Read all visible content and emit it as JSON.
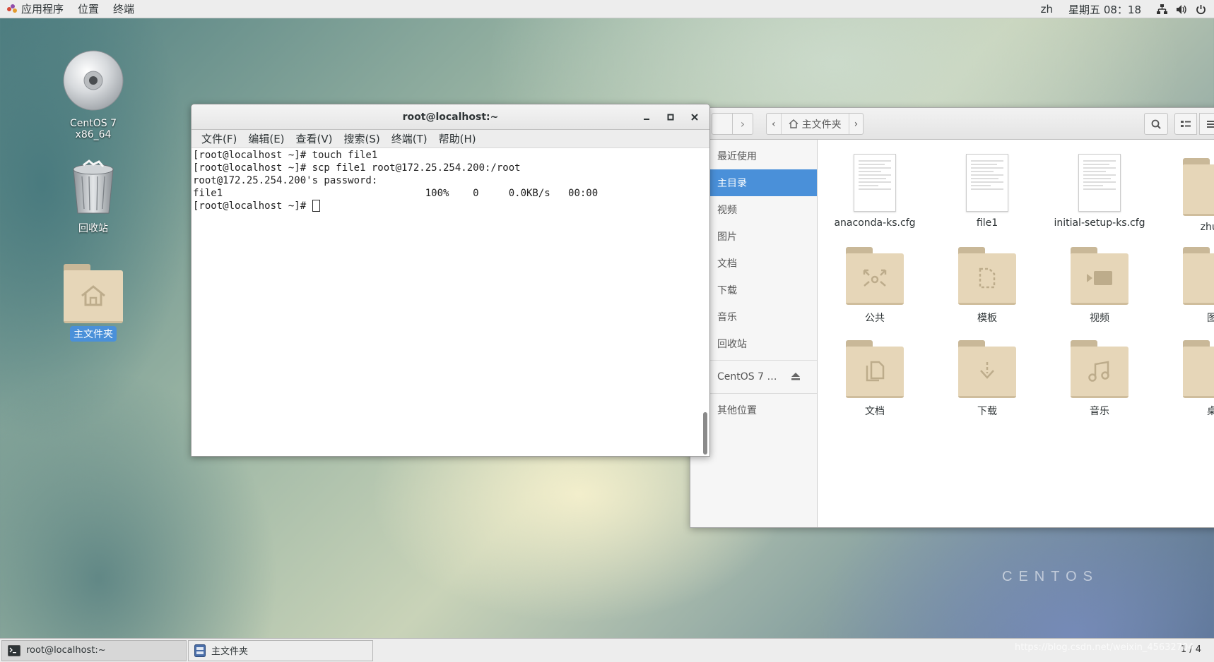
{
  "topbar": {
    "apps": "应用程序",
    "places": "位置",
    "terminal": "终端",
    "lang": "zh",
    "clock": "星期五 08：18",
    "icons": [
      "network-icon",
      "volume-icon",
      "power-icon"
    ]
  },
  "desktop": {
    "icons": [
      {
        "label": "CentOS 7 x86_64",
        "icon": "disc-icon"
      },
      {
        "label": "回收站",
        "icon": "trash-icon"
      },
      {
        "label": "主文件夹",
        "icon": "home-folder-icon"
      }
    ],
    "logo": "CENTOS"
  },
  "terminal": {
    "title": "root@localhost:~",
    "menu": [
      "文件(F)",
      "编辑(E)",
      "查看(V)",
      "搜索(S)",
      "终端(T)",
      "帮助(H)"
    ],
    "lines": [
      "[root@localhost ~]# touch file1",
      "[root@localhost ~]# scp file1 root@172.25.254.200:/root",
      "root@172.25.254.200's password: ",
      "file1                                  100%    0     0.0KB/s   00:00    ",
      "[root@localhost ~]# "
    ]
  },
  "filemanager": {
    "breadcrumb": "主文件夹",
    "sidebar": [
      "最近使用",
      "主目录",
      "视频",
      "图片",
      "文档",
      "下载",
      "音乐",
      "回收站",
      "CentOS 7 …",
      "其他位置"
    ],
    "files": [
      {
        "name": "anaconda-ks.cfg",
        "type": "doc"
      },
      {
        "name": "file1",
        "type": "doc"
      },
      {
        "name": "initial-setup-ks.cfg",
        "type": "doc"
      },
      {
        "name": "zhuc",
        "type": "folder"
      },
      {
        "name": "公共",
        "type": "folder"
      },
      {
        "name": "模板",
        "type": "folder"
      },
      {
        "name": "视频",
        "type": "folder"
      },
      {
        "name": "图",
        "type": "folder"
      },
      {
        "name": "文档",
        "type": "folder"
      },
      {
        "name": "下载",
        "type": "folder"
      },
      {
        "name": "音乐",
        "type": "folder"
      },
      {
        "name": "桌",
        "type": "folder"
      }
    ]
  },
  "taskbar": {
    "tasks": [
      "root@localhost:~",
      "主文件夹"
    ],
    "pager": "1 / 4"
  },
  "watermark": "https://blog.csdn.net/weixin_45632704"
}
